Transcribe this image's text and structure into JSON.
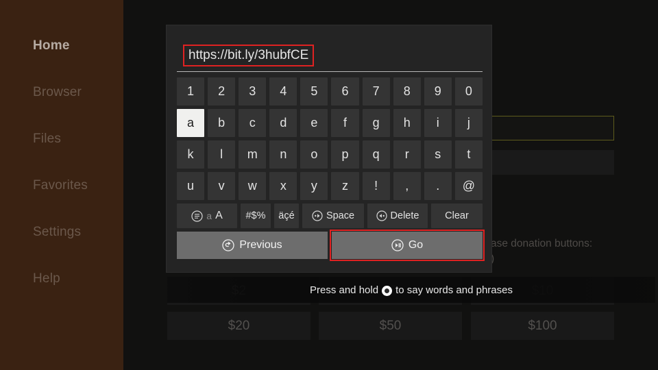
{
  "sidebar": {
    "items": [
      {
        "label": "Home",
        "active": true
      },
      {
        "label": "Browser",
        "active": false
      },
      {
        "label": "Files",
        "active": false
      },
      {
        "label": "Favorites",
        "active": false
      },
      {
        "label": "Settings",
        "active": false
      },
      {
        "label": "Help",
        "active": false
      }
    ],
    "background_color": "#3a2212"
  },
  "background": {
    "field_border_color": "#5e5b1c",
    "donation_caption_line1": "ase donation buttons:",
    "donation_caption_line2": ")",
    "donation_buttons": [
      {
        "label": "$2"
      },
      {
        "label": "$5"
      },
      {
        "label": "$10"
      },
      {
        "label": "$20"
      },
      {
        "label": "$50"
      },
      {
        "label": "$100"
      }
    ]
  },
  "voice_hint": {
    "text_before": "Press and hold",
    "text_after": "to say words and phrases",
    "icon": "mic-dot-icon"
  },
  "keyboard": {
    "input": {
      "value": "https://bit.ly/3hubfCE",
      "placeholder": "",
      "focus_color": "#e02222"
    },
    "rows": [
      {
        "keys": [
          "1",
          "2",
          "3",
          "4",
          "5",
          "6",
          "7",
          "8",
          "9",
          "0"
        ]
      },
      {
        "keys": [
          "a",
          "b",
          "c",
          "d",
          "e",
          "f",
          "g",
          "h",
          "i",
          "j"
        ],
        "selected": "a"
      },
      {
        "keys": [
          "k",
          "l",
          "m",
          "n",
          "o",
          "p",
          "q",
          "r",
          "s",
          "t"
        ]
      },
      {
        "keys": [
          "u",
          "v",
          "w",
          "x",
          "y",
          "z",
          "!",
          ",",
          ".",
          "@"
        ]
      }
    ],
    "function_row": {
      "case_toggle": {
        "icon": "circle-menu-icon",
        "lower": "a",
        "upper": "A"
      },
      "symbols": "#$%",
      "accents": "äçé",
      "space": {
        "icon": "fast-forward-icon",
        "label": "Space"
      },
      "delete": {
        "icon": "rewind-icon",
        "label": "Delete"
      },
      "clear": "Clear"
    },
    "bottom_buttons": [
      {
        "icon": "back-circle-icon",
        "label": "Previous",
        "focused": false
      },
      {
        "icon": "play-pause-circle-icon",
        "label": "Go",
        "focused": true
      }
    ]
  }
}
